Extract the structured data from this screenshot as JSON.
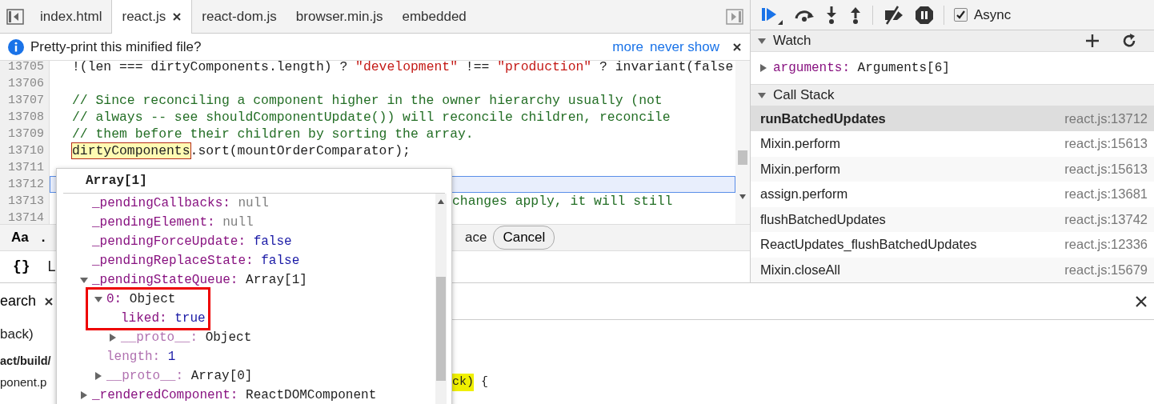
{
  "editor": {
    "tabs": [
      {
        "label": "index.html",
        "selected": false,
        "closable": false
      },
      {
        "label": "react.js",
        "selected": true,
        "closable": true
      },
      {
        "label": "react-dom.js",
        "selected": false,
        "closable": false
      },
      {
        "label": "browser.min.js",
        "selected": false,
        "closable": false
      },
      {
        "label": "embedded",
        "selected": false,
        "closable": false
      }
    ],
    "infobar": {
      "message": "Pretty-print this minified file?",
      "links": [
        "more",
        "never show"
      ]
    },
    "lines": [
      {
        "number": "13705",
        "current": false,
        "tokens": [
          {
            "kind": "plain",
            "text": "!(len === dirtyComponents.length) ? "
          },
          {
            "kind": "string",
            "text": "\"development\""
          },
          {
            "kind": "plain",
            "text": " !== "
          },
          {
            "kind": "string",
            "text": "\"production\""
          },
          {
            "kind": "plain",
            "text": " ? invariant(false"
          }
        ]
      },
      {
        "number": "13706",
        "current": false
      },
      {
        "number": "13707",
        "current": false,
        "tokens": [
          {
            "kind": "comment",
            "text": "// Since reconciling a component higher in the owner hierarchy usually (not"
          }
        ]
      },
      {
        "number": "13708",
        "current": false,
        "tokens": [
          {
            "kind": "comment",
            "text": "// always -- see shouldComponentUpdate()) will reconcile children, reconcile"
          }
        ]
      },
      {
        "number": "13709",
        "current": false,
        "tokens": [
          {
            "kind": "comment",
            "text": "// them before their children by sorting the array."
          }
        ]
      },
      {
        "number": "13710",
        "current": false,
        "tokens": [
          {
            "kind": "hover",
            "text": "dirtyComponents"
          },
          {
            "kind": "plain",
            "text": ".sort(mountOrderComparator);"
          }
        ]
      },
      {
        "number": "13711",
        "current": false
      },
      {
        "number": "13712",
        "current": true
      },
      {
        "number": "13713",
        "current": false,
        "covered": true,
        "tokens": [
          {
            "kind": "comment",
            "text": "changes apply, it will still"
          }
        ]
      },
      {
        "number": "13714",
        "current": false
      }
    ],
    "search_bar": {
      "case_label": "Aa",
      "regex_label": ".",
      "replace_label": "ace",
      "cancel_label": "Cancel"
    },
    "status_bar": {
      "format_label": "{}",
      "text": "L"
    }
  },
  "popover": {
    "title": "Array[1]",
    "items": [
      {
        "key": "_pendingCallbacks:",
        "value": "null",
        "kind": "null",
        "internal": false,
        "expandable": false,
        "outlined": false
      },
      {
        "key": "_pendingElement:",
        "value": "null",
        "kind": "null",
        "internal": false,
        "expandable": false,
        "outlined": false
      },
      {
        "key": "_pendingForceUpdate:",
        "value": "false",
        "kind": "boolean",
        "internal": false,
        "expandable": false,
        "outlined": false
      },
      {
        "key": "_pendingReplaceState:",
        "value": "false",
        "kind": "boolean",
        "internal": false,
        "expandable": false,
        "outlined": false
      },
      {
        "key": "_pendingStateQueue:",
        "value": "Array[1]",
        "kind": "object",
        "internal": false,
        "expandable": true,
        "expanded": true,
        "outlined": false,
        "children": [
          {
            "key": "0:",
            "value": "Object",
            "kind": "object",
            "internal": false,
            "expandable": true,
            "expanded": true,
            "outlined": true,
            "children": [
              {
                "key": "liked:",
                "value": "true",
                "kind": "boolean",
                "internal": false,
                "expandable": false,
                "outlined": true
              },
              {
                "key": "__proto__:",
                "value": "Object",
                "kind": "object",
                "internal": true,
                "expandable": true,
                "expanded": false,
                "outlined": false
              }
            ]
          },
          {
            "key": "length:",
            "value": "1",
            "kind": "number",
            "internal": true,
            "expandable": false,
            "outlined": false
          },
          {
            "key": "__proto__:",
            "value": "Array[0]",
            "kind": "object",
            "internal": true,
            "expandable": true,
            "expanded": false,
            "outlined": false
          }
        ]
      },
      {
        "key": "_renderedComponent:",
        "value": "ReactDOMComponent",
        "kind": "object",
        "internal": false,
        "expandable": true,
        "expanded": false,
        "outlined": false
      }
    ]
  },
  "sidebar": {
    "async": {
      "label": "Async",
      "checked": true
    },
    "watch": {
      "title": "Watch",
      "expanded": true,
      "items": [
        {
          "key": "arguments:",
          "value": "Arguments[6]",
          "expanded": false
        }
      ]
    },
    "call_stack": {
      "title": "Call Stack",
      "expanded": true,
      "frames": [
        {
          "function": "runBatchedUpdates",
          "location": "react.js:13712",
          "selected": true
        },
        {
          "function": "Mixin.perform",
          "location": "react.js:15613",
          "selected": false
        },
        {
          "function": "Mixin.perform",
          "location": "react.js:15613",
          "selected": false
        },
        {
          "function": "assign.perform",
          "location": "react.js:13681",
          "selected": false
        },
        {
          "function": "flushBatchedUpdates",
          "location": "react.js:13742",
          "selected": false
        },
        {
          "function": "ReactUpdates_flushBatchedUpdates",
          "location": "react.js:12336",
          "selected": false
        },
        {
          "function": "Mixin.closeAll",
          "location": "react.js:15679",
          "selected": false
        }
      ]
    }
  },
  "drawer": {
    "tab": {
      "label": "earch",
      "selected": true
    },
    "query": "back)",
    "results": [
      {
        "kind": "file",
        "text": "act/build/"
      },
      {
        "kind": "match",
        "before": "ponent.p",
        "match": "ck)",
        "after": " {"
      }
    ]
  }
}
